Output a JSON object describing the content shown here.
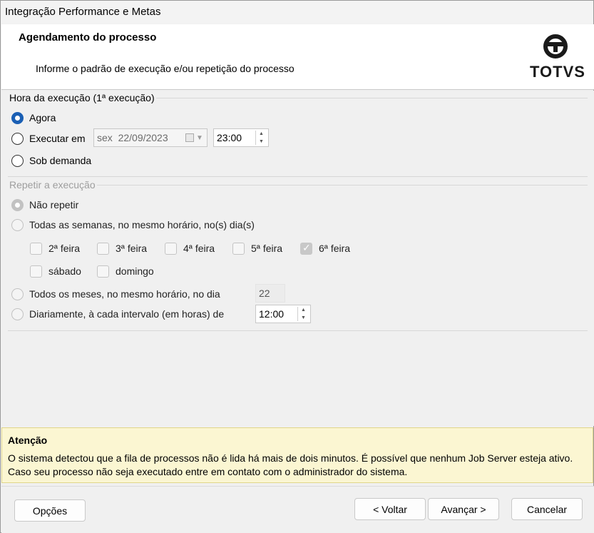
{
  "window": {
    "title": "Integração Performance e Metas"
  },
  "header": {
    "title": "Agendamento do processo",
    "subtitle": "Informe o padrão de execução e/ou repetição do processo",
    "logo_text": "TOTVS"
  },
  "exec_time": {
    "legend": "Hora da execução (1ª execução)",
    "options": [
      {
        "label": "Agora",
        "checked": true
      },
      {
        "label": "Executar em",
        "checked": false
      },
      {
        "label": "Sob demanda",
        "checked": false
      }
    ],
    "date_value": "sex  22/09/2023",
    "time_value": "23:00"
  },
  "repeat": {
    "legend": "Repetir a execução",
    "options": {
      "none": "Não repetir",
      "weekly": "Todas as semanas, no mesmo horário, no(s) dia(s)",
      "monthly": "Todos os meses, no mesmo horário, no dia",
      "daily": "Diariamente, à cada intervalo (em horas) de"
    },
    "days": [
      {
        "label": "2ª feira",
        "checked": false
      },
      {
        "label": "3ª feira",
        "checked": false
      },
      {
        "label": "4ª feira",
        "checked": false
      },
      {
        "label": "5ª feira",
        "checked": false
      },
      {
        "label": "6ª feira",
        "checked": true
      },
      {
        "label": "sábado",
        "checked": false
      },
      {
        "label": "domingo",
        "checked": false
      }
    ],
    "month_day": "22",
    "interval": "12:00"
  },
  "warning": {
    "title": "Atenção",
    "text": "O sistema detectou que a fila de processos não é lida há mais de dois minutos. É possível que nenhum Job Server esteja ativo. Caso seu processo não seja executado entre em contato com o administrador do sistema."
  },
  "buttons": {
    "options": "Opções",
    "back": "< Voltar",
    "next": "Avançar >",
    "cancel": "Cancelar"
  }
}
